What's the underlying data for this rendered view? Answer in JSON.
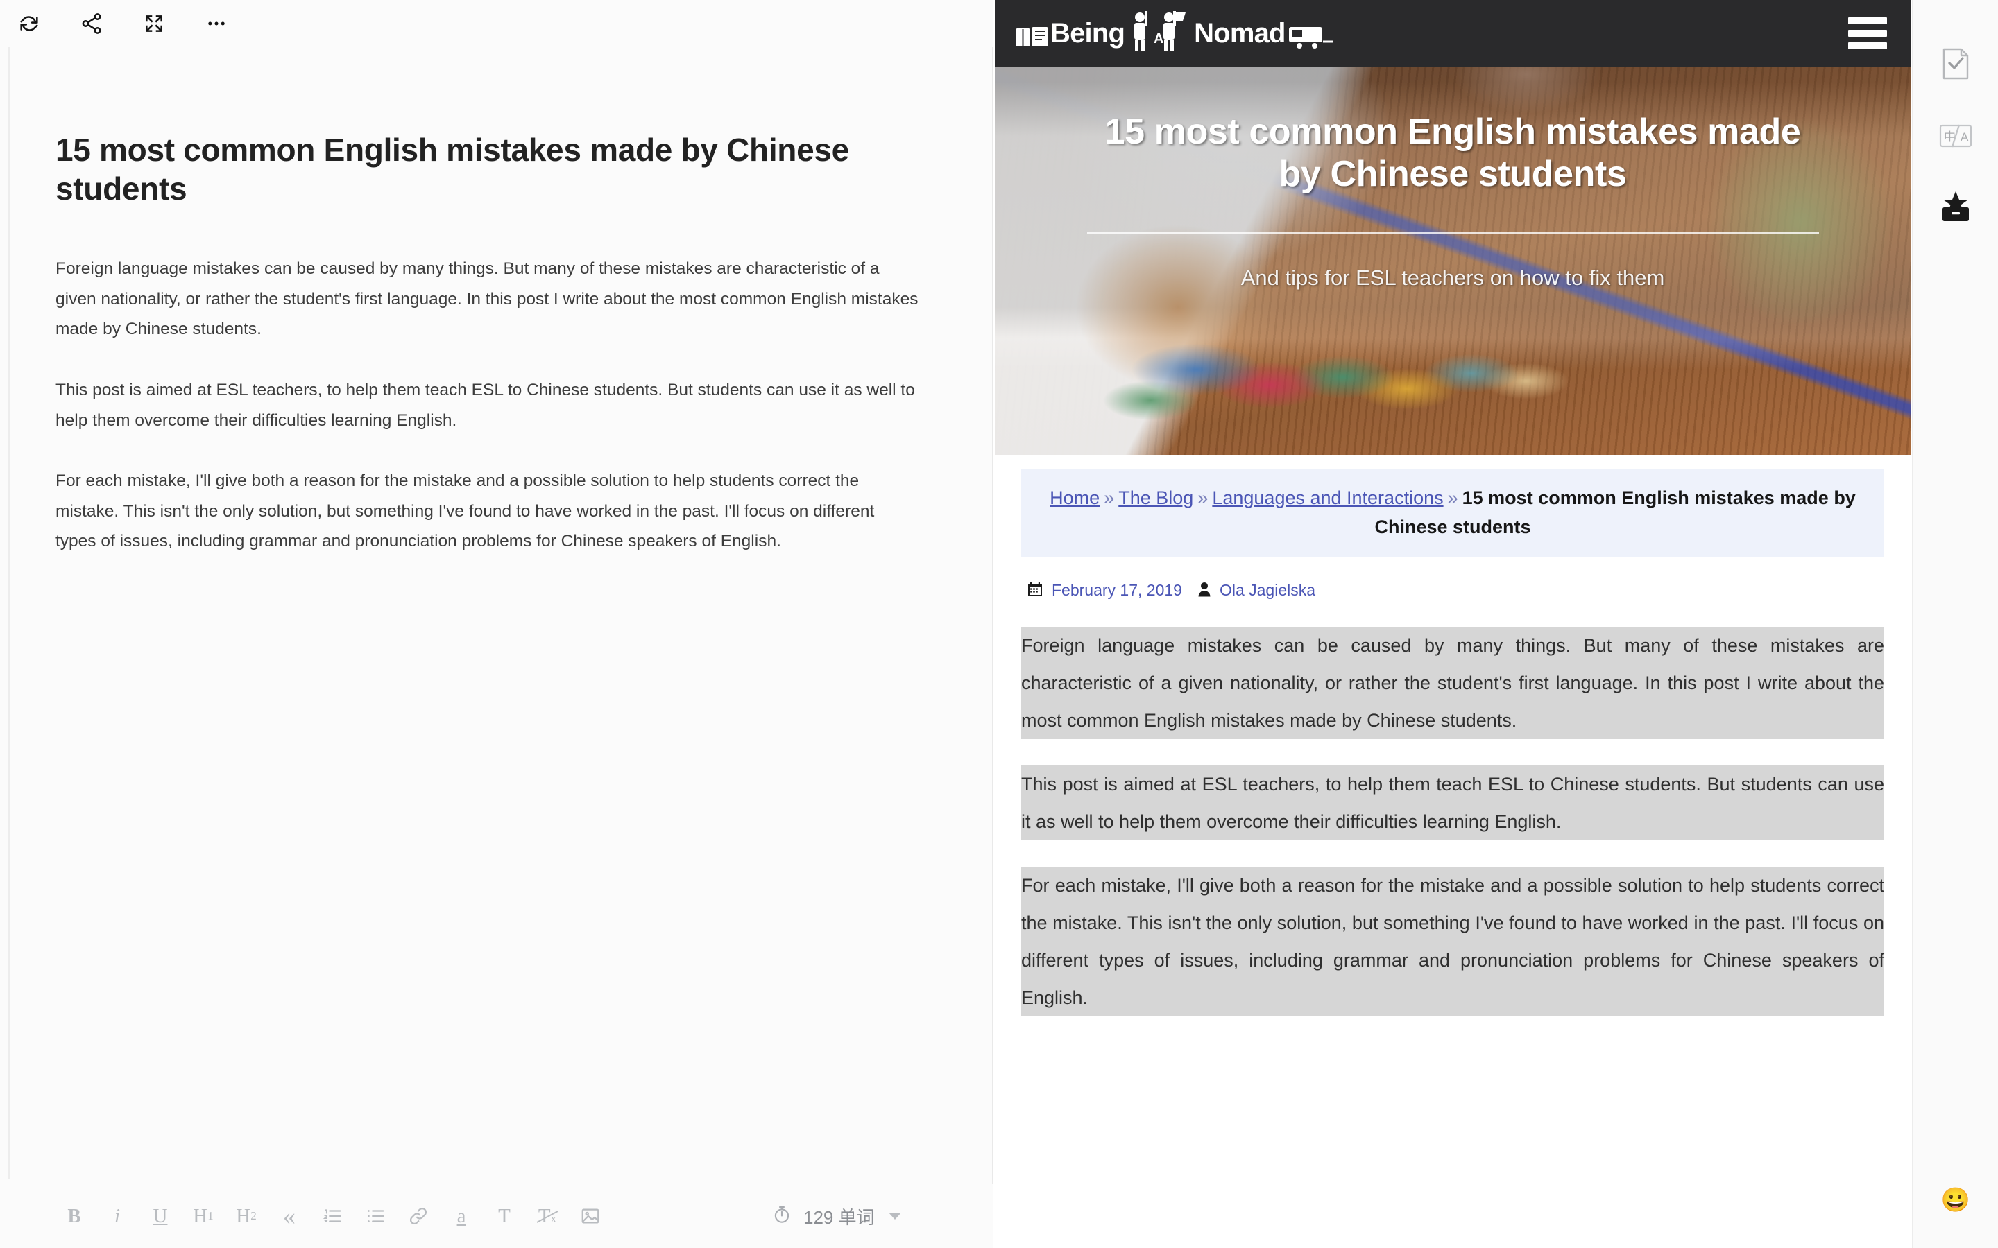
{
  "editor": {
    "toolbar_top": [
      {
        "name": "sync-icon",
        "label": "Sync"
      },
      {
        "name": "share-icon",
        "label": "Share"
      },
      {
        "name": "fullscreen-icon",
        "label": "Fullscreen"
      },
      {
        "name": "more-icon",
        "label": "More"
      }
    ],
    "document": {
      "title": "15 most common English mistakes made by Chinese students",
      "paragraphs": [
        "Foreign language mistakes can be caused by many things. But many of these mistakes are characteristic of a given nationality, or rather the student's first language. In this post I write about the most common English mistakes made by Chinese students.",
        "This post is aimed at ESL teachers, to help them teach ESL to Chinese students. But students can use it as well to help them overcome their difficulties learning English.",
        "For each mistake, I'll give both a reason for the mistake and a possible solution to help students correct the mistake. This isn't the only solution, but something I've found to have worked in the past. I'll focus on different types of issues, including grammar and pronunciation problems for Chinese speakers of English."
      ]
    },
    "toolbar_bottom": {
      "format_buttons": [
        {
          "name": "bold-button",
          "label": "B"
        },
        {
          "name": "italic-button",
          "label": "i"
        },
        {
          "name": "underline-button",
          "label": "U"
        },
        {
          "name": "heading1-button",
          "label": "H1"
        },
        {
          "name": "heading2-button",
          "label": "H2"
        },
        {
          "name": "blockquote-button",
          "label": "«"
        },
        {
          "name": "ordered-list-button",
          "label": "ol"
        },
        {
          "name": "unordered-list-button",
          "label": "ul"
        },
        {
          "name": "link-button",
          "label": "link"
        },
        {
          "name": "highlight-button",
          "label": "a"
        },
        {
          "name": "text-color-button",
          "label": "T"
        },
        {
          "name": "clear-format-button",
          "label": "Tx"
        },
        {
          "name": "insert-image-button",
          "label": "img"
        }
      ],
      "word_count": "129 单词",
      "timer_icon": "stopwatch-icon"
    }
  },
  "preview": {
    "site": {
      "logo_text_1": "Being",
      "logo_text_2": "A",
      "logo_text_3": "Nomad",
      "menu_label": "Menu"
    },
    "hero": {
      "title": "15 most common English mistakes made by Chinese students",
      "subtitle": "And tips for ESL teachers on how to fix them"
    },
    "breadcrumb": {
      "items": [
        {
          "label": "Home",
          "current": false
        },
        {
          "label": "The Blog",
          "current": false
        },
        {
          "label": "Languages and Interactions",
          "current": false
        },
        {
          "label": "15 most common English mistakes made by Chinese students",
          "current": true
        }
      ],
      "separator": "»"
    },
    "meta": {
      "date": "February 17, 2019",
      "author": "Ola Jagielska",
      "date_icon": "calendar-icon",
      "author_icon": "user-icon"
    },
    "paragraphs": [
      "Foreign language mistakes can be caused by many things. But many of these mistakes are characteristic of a given nationality, or rather the student's first language. In this post I write about the most common English mistakes made by Chinese students.",
      "This post is aimed at ESL teachers, to help them teach ESL to Chinese students. But students can use it as well to help them overcome their difficulties learning English.",
      "For each mistake, I'll give both a reason for the mistake and a possible solution to help students correct the mistake. This isn't the only solution, but something I've found to have worked in the past. I'll focus on different types of issues, including grammar and pronunciation problems for Chinese speakers of English."
    ]
  },
  "tool_rail": {
    "buttons": [
      {
        "name": "proofread-icon",
        "label": "Proofread"
      },
      {
        "name": "translate-icon",
        "label": "Translate"
      },
      {
        "name": "toolbox-icon",
        "label": "Toolbox"
      }
    ],
    "emoji": "😀"
  },
  "colors": {
    "accent_link": "#4a55b5",
    "breadcrumb_bg": "#eef2fb",
    "selection_bg": "#d6d6d6",
    "header_bg": "#2a2a2c"
  }
}
